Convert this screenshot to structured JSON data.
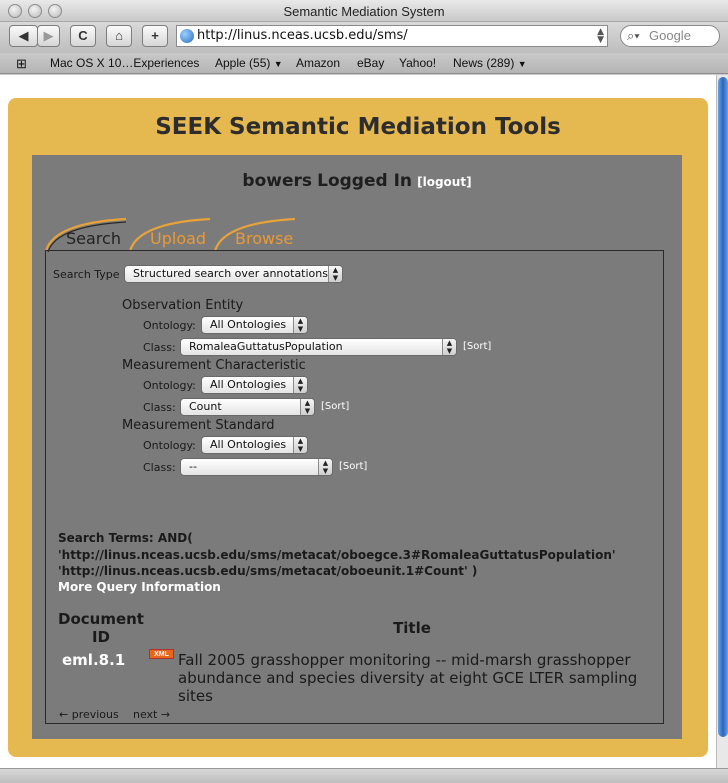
{
  "window": {
    "title": "Semantic Mediation System",
    "url": "http://linus.nceas.ucsb.edu/sms/",
    "search_placeholder": "Google"
  },
  "toolbar": {
    "back": "◀",
    "forward": "▶",
    "reload": "C",
    "home": "⌂",
    "add": "+"
  },
  "bookmarks": [
    "Mac OS X 10…Experiences",
    "Apple (55)",
    "Amazon",
    "eBay",
    "Yahoo!",
    "News (289)"
  ],
  "page": {
    "heading": "SEEK Semantic Mediation Tools",
    "user": "bowers",
    "login_state": "Logged In",
    "logout": "[logout]",
    "tabs": [
      "Search",
      "Upload",
      "Browse"
    ],
    "search_type_label": "Search Type",
    "search_type_value": "Structured search over annotations",
    "sections": [
      {
        "title": "Observation Entity",
        "ontology_label": "Ontology:",
        "ontology_value": "All Ontologies",
        "class_label": "Class:",
        "class_value": "RomaleaGuttatusPopulation",
        "sort": "[Sort]"
      },
      {
        "title": "Measurement Characteristic",
        "ontology_label": "Ontology:",
        "ontology_value": "All Ontologies",
        "class_label": "Class:",
        "class_value": "Count",
        "sort": "[Sort]"
      },
      {
        "title": "Measurement Standard",
        "ontology_label": "Ontology:",
        "ontology_value": "All Ontologies",
        "class_label": "Class:",
        "class_value": "--",
        "sort": "[Sort]"
      }
    ],
    "search_terms": [
      "Search Terms: AND(",
      "'http://linus.nceas.ucsb.edu/sms/metacat/oboegce.3#RomaleaGuttatusPopulation'",
      "'http://linus.nceas.ucsb.edu/sms/metacat/oboeunit.1#Count'   )"
    ],
    "more_query": "More Query Information",
    "results": {
      "col_docid": "Document ID",
      "col_title": "Title",
      "rows": [
        {
          "docid": "eml.8.1",
          "xml_badge": "XML",
          "title": "Fall 2005 grasshopper monitoring -- mid-marsh grasshopper abundance and species diversity at eight GCE LTER sampling sites"
        }
      ]
    },
    "pager": {
      "previous": "← previous",
      "next": "next →"
    }
  },
  "colors": {
    "accent_gold": "#e5b94f",
    "panel_gray": "#7b7b7b",
    "tab_orange": "#e99a35"
  }
}
